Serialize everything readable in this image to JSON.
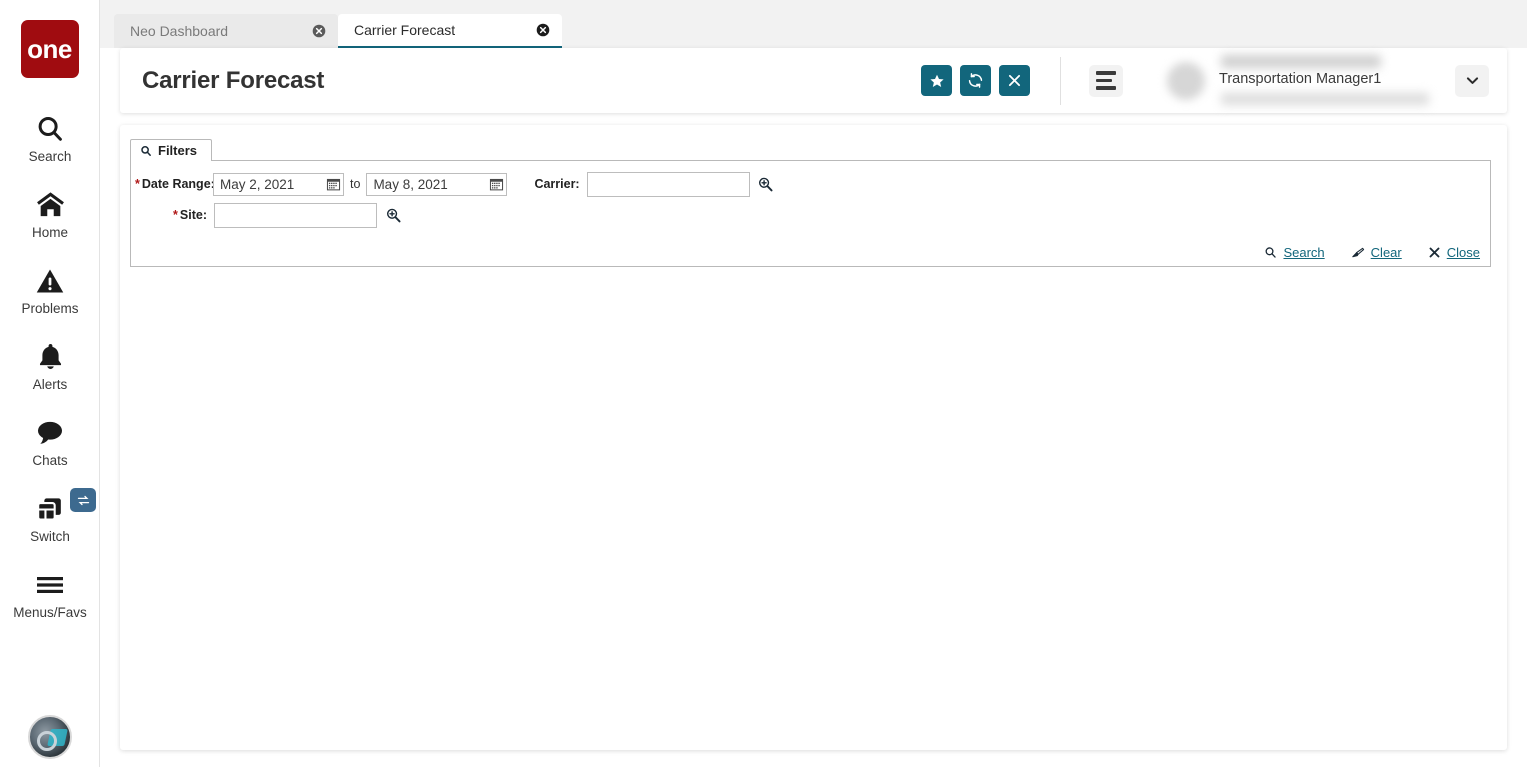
{
  "brand": {
    "logo_text": "one",
    "logo_color": "#A00C10",
    "accent_color": "#12667C",
    "badge_color": "#3D6A8F"
  },
  "sidebar": {
    "items": [
      {
        "label": "Search",
        "icon": "search-icon"
      },
      {
        "label": "Home",
        "icon": "home-icon"
      },
      {
        "label": "Problems",
        "icon": "warning-triangle-icon"
      },
      {
        "label": "Alerts",
        "icon": "bell-icon"
      },
      {
        "label": "Chats",
        "icon": "chat-bubble-icon"
      },
      {
        "label": "Switch",
        "icon": "windows-stack-icon",
        "badge_icon": "swap-arrows-icon"
      },
      {
        "label": "Menus/Favs",
        "icon": "hamburger-icon"
      }
    ],
    "avatar_icon": "user-avatar-icon"
  },
  "tabs": [
    {
      "label": "Neo Dashboard",
      "active": false,
      "close_icon": "close-circle-icon"
    },
    {
      "label": "Carrier Forecast",
      "active": true,
      "close_icon": "close-circle-icon"
    }
  ],
  "header": {
    "title": "Carrier Forecast",
    "buttons": [
      {
        "name": "favorite-button",
        "icon": "star-icon"
      },
      {
        "name": "refresh-button",
        "icon": "refresh-icon"
      },
      {
        "name": "close-button",
        "icon": "x-icon"
      }
    ],
    "menu_icon": "hamburger-menu-icon",
    "user": {
      "role": "Transportation Manager1",
      "name_hidden": "",
      "org_hidden": ""
    },
    "caret_icon": "chevron-down-icon"
  },
  "filters": {
    "tab_label": "Filters",
    "tab_icon": "search-icon",
    "date_range": {
      "label": "Date Range:",
      "required": true,
      "from_value": "May 2, 2021",
      "to_value": "May 8, 2021",
      "separator": "to",
      "calendar_icon": "calendar-icon"
    },
    "site": {
      "label": "Site:",
      "required": true,
      "value": "",
      "placeholder": "",
      "lookup_icon": "magnifier-plus-icon"
    },
    "carrier": {
      "label": "Carrier:",
      "required": false,
      "value": "",
      "placeholder": "",
      "lookup_icon": "magnifier-plus-icon"
    },
    "actions": [
      {
        "label": "Search",
        "icon": "magnifier-icon",
        "name": "filters-search-link"
      },
      {
        "label": "Clear",
        "icon": "eraser-icon",
        "name": "filters-clear-link"
      },
      {
        "label": "Close",
        "icon": "x-icon",
        "name": "filters-close-link"
      }
    ]
  }
}
